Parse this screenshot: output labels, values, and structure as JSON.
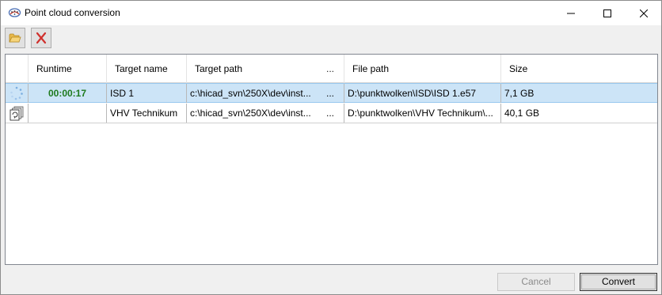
{
  "window": {
    "title": "Point cloud conversion"
  },
  "toolbar": {
    "open_icon": "folder-open-icon",
    "delete_icon": "delete-x-icon"
  },
  "grid": {
    "columns": [
      {
        "label": "",
        "name": "status"
      },
      {
        "label": "Runtime",
        "name": "runtime"
      },
      {
        "label": "Target name",
        "name": "target-name"
      },
      {
        "label": "Target path",
        "name": "target-path",
        "more": "..."
      },
      {
        "label": "File path",
        "name": "file-path"
      },
      {
        "label": "Size",
        "name": "size"
      }
    ],
    "rows": [
      {
        "status_icon": "loading-spinner-icon",
        "runtime": "00:00:17",
        "target_name": "ISD 1",
        "target_path": "c:\\hicad_svn\\250X\\dev\\inst...",
        "target_path_more": "...",
        "file_path": "D:\\punktwolken\\ISD\\ISD 1.e57",
        "size": "7,1 GB"
      },
      {
        "status_icon": "queued-pages-icon",
        "runtime": "",
        "target_name": "VHV Technikum",
        "target_path": "c:\\hicad_svn\\250X\\dev\\inst...",
        "target_path_more": "...",
        "file_path": "D:\\punktwolken\\VHV Technikum\\...",
        "size": "40,1 GB"
      }
    ]
  },
  "buttons": {
    "cancel": "Cancel",
    "convert": "Convert"
  },
  "colors": {
    "selection": "#cce4f7",
    "runtime": "#1e7a1e"
  }
}
